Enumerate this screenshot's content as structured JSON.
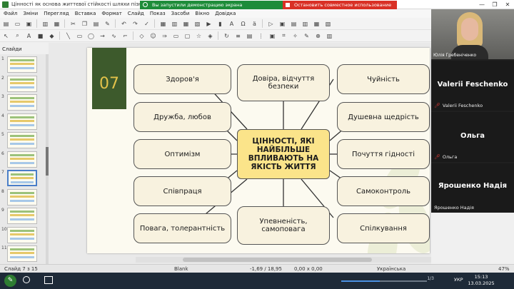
{
  "window": {
    "title": "Цінності як основа життєвої стійкості шляхи пізнання та акти",
    "share_text": "Вы запустили демонстрацию экрана",
    "stop_share_text": "Остановить совместное использование",
    "controls": [
      "—",
      "❐",
      "✕"
    ]
  },
  "menu": [
    "Файл",
    "Зміни",
    "Перегляд",
    "Вставка",
    "Формат",
    "Слайд",
    "Показ",
    "Засоби",
    "Вікно",
    "Довідка"
  ],
  "slides_panel": {
    "label": "Слайди",
    "thumbnails": [
      "1",
      "2",
      "3",
      "4",
      "5",
      "6",
      "7",
      "8",
      "9",
      "10",
      "11"
    ],
    "selected_index": 6
  },
  "slide": {
    "number": "07",
    "center": "ЦІННОСТІ, ЯКІ НАЙБІЛЬШЕ ВПЛИВАЮТЬ НА ЯКІСТЬ ЖИТТЯ",
    "boxes": {
      "health": "Здоров'я",
      "trust": "Довіра, відчуття безпеки",
      "empathy": "Чуйність",
      "friendship": "Дружба, любов",
      "generosity": "Душевна щедрість",
      "optimism": "Оптимізм",
      "dignity": "Почуття гідності",
      "cooperation": "Співпраця",
      "selfcontrol": "Самоконтроль",
      "respect": "Повага, толерантність",
      "confidence": "Упевненість, самоповага",
      "communication": "Спілкування"
    }
  },
  "video": {
    "self_name": "Юлія Гребеніченко",
    "participants": [
      {
        "big": "Valerii Feschenko",
        "small": "Valerii Feschenko",
        "muted": true
      },
      {
        "big": "Ольга",
        "small": "Ольга",
        "muted": true
      },
      {
        "big": "Ярошенко Надія",
        "small": "Ярошенко Надія",
        "muted": false
      }
    ]
  },
  "status": {
    "slide": "Слайд 7 з 15",
    "layout": "Blank",
    "position": "-1,69 / 18,95",
    "size": "0,00 x 0,00",
    "language": "Українська",
    "zoom": "47%"
  },
  "taskbar": {
    "progress_count": "1/3",
    "progress_fraction": 0.45,
    "lang": "УКР",
    "time": "15:13",
    "date": "13.03.2025"
  }
}
